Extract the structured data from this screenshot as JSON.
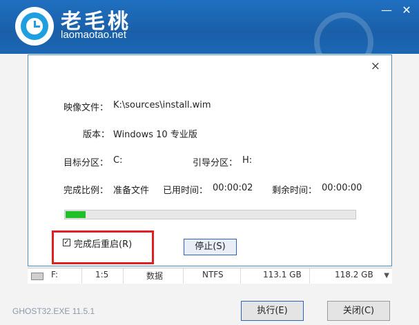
{
  "header": {
    "brand": "老毛桃",
    "url": "laomaotao.net",
    "minimize_glyph": "—",
    "close_glyph": "✕"
  },
  "dialog": {
    "close_glyph": "×",
    "image_file_label": "映像文件：",
    "image_file_value": "K:\\sources\\install.wim",
    "version_label": "版本：",
    "version_value": "Windows 10 专业版",
    "target_partition_label": "目标分区：",
    "target_partition_value": "C:",
    "boot_partition_label": "引导分区：",
    "boot_partition_value": "H:",
    "completion_label": "完成比例：",
    "completion_value": "准备文件",
    "elapsed_label": "已用时间：",
    "elapsed_value": "00:00:02",
    "remaining_label": "剩余时间：",
    "remaining_value": "00:00:00",
    "progress_fraction": 0.07,
    "restart_checkbox_label": "完成后重启(R)",
    "restart_checked": true,
    "stop_button": "停止(S)"
  },
  "disk_row": {
    "drive": "F:",
    "index": "1:5",
    "type": "数据",
    "fs": "NTFS",
    "size1": "113.1 GB",
    "size2": "118.2 GB"
  },
  "footer": {
    "version": "GHOST32.EXE 11.5.1",
    "execute_button": "执行(E)",
    "close_button": "关闭(C)"
  },
  "colors": {
    "header_blue": "#1a5fa8",
    "progress_green": "#1fbf2a",
    "highlight_red": "#e02020"
  }
}
